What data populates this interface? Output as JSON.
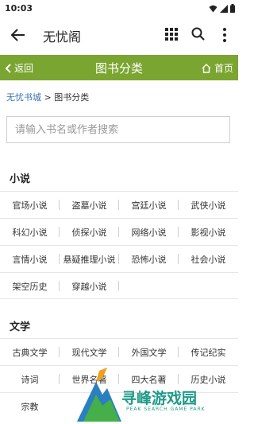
{
  "statusbar": {
    "time": "10:03"
  },
  "appbar": {
    "title": "无忧阁"
  },
  "banner": {
    "back_label": "返回",
    "title": "图书分类",
    "home_label": "首页"
  },
  "breadcrumb": {
    "home": "无忧书城",
    "sep": ">",
    "current": "图书分类"
  },
  "search": {
    "placeholder": "请输入书名或作者搜索",
    "value": ""
  },
  "sections": [
    {
      "title": "小说",
      "rows": [
        [
          "官场小说",
          "盗墓小说",
          "宫廷小说",
          "武侠小说"
        ],
        [
          "科幻小说",
          "侦探小说",
          "网络小说",
          "影视小说"
        ],
        [
          "言情小说",
          "悬疑推理小说",
          "恐怖小说",
          "社会小说"
        ],
        [
          "架空历史",
          "穿越小说"
        ]
      ]
    },
    {
      "title": "文学",
      "rows": [
        [
          "古典文学",
          "现代文学",
          "外国文学",
          "传记纪实"
        ],
        [
          "诗词",
          "世界名著",
          "四大名著",
          "历史小说"
        ],
        [
          "宗教"
        ]
      ]
    }
  ],
  "watermark": {
    "title": "寻峰游戏园",
    "subtitle": "PEAK SEARCH GAME PARK"
  },
  "colors": {
    "banner": "#7aa530",
    "link": "#3a6fb0",
    "watermark": "#1f9a88"
  }
}
